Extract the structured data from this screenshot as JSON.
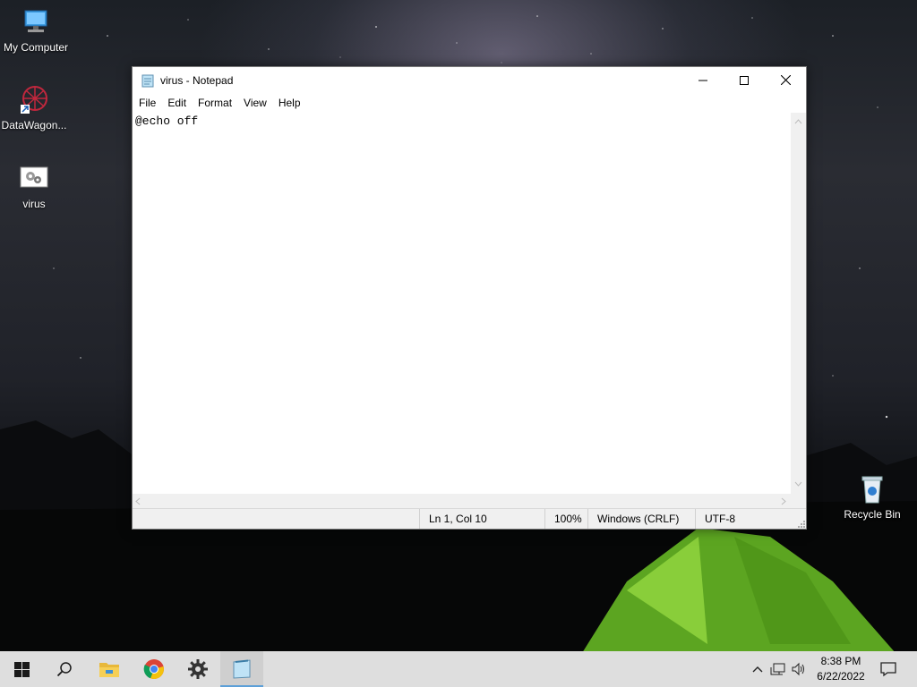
{
  "desktop": {
    "icons": [
      {
        "label": "My Computer",
        "icon": "computer-icon"
      },
      {
        "label": "DataWagon...",
        "icon": "datawagon-shortcut-icon"
      },
      {
        "label": "virus",
        "icon": "batch-file-icon"
      },
      {
        "label": "Recycle Bin",
        "icon": "recycle-bin-icon"
      }
    ]
  },
  "notepad": {
    "title": "virus - Notepad",
    "menu": [
      "File",
      "Edit",
      "Format",
      "View",
      "Help"
    ],
    "content": "@echo off",
    "status": {
      "position": "Ln 1, Col 10",
      "zoom": "100%",
      "line_ending": "Windows (CRLF)",
      "encoding": "UTF-8"
    }
  },
  "taskbar": {
    "apps": [
      "start-icon",
      "search-icon",
      "file-explorer-icon",
      "chrome-icon",
      "settings-icon",
      "notepad-icon"
    ],
    "active_app": "notepad-icon",
    "clock": {
      "time": "8:38 PM",
      "date": "6/22/2022"
    }
  },
  "colors": {
    "accent": "#5da0d8",
    "taskbar": "#dedede",
    "tent_green": "#7fd02a"
  }
}
